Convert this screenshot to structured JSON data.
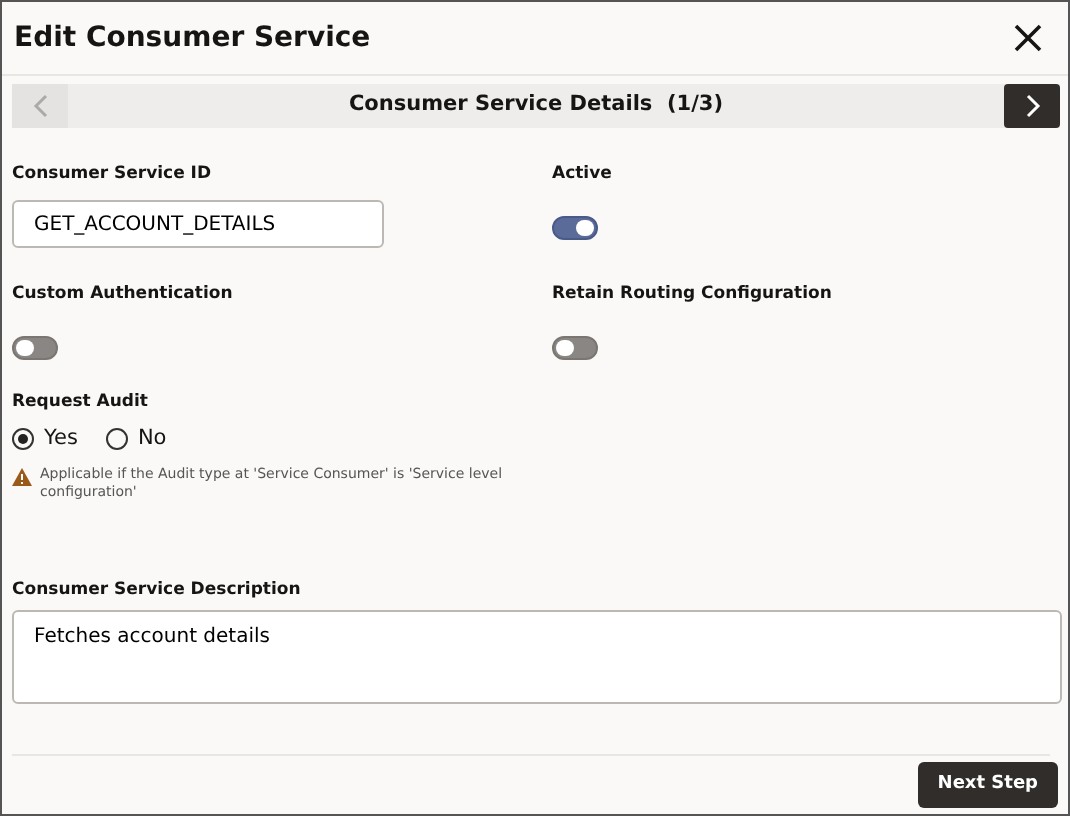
{
  "dialog": {
    "title": "Edit Consumer Service"
  },
  "stepper": {
    "title": "Consumer Service Details  (1/3)",
    "prev_disabled": true,
    "next_disabled": false
  },
  "fields": [
    {
      "label": "Consumer Service ID",
      "kind": "text",
      "value": "GET_ACCOUNT_DETAILS"
    },
    {
      "label": "Active",
      "kind": "toggle",
      "on": true
    },
    {
      "label": "Custom Authentication",
      "kind": "toggle",
      "on": false
    },
    {
      "label": "Retain Routing Configuration",
      "kind": "toggle",
      "on": false
    }
  ],
  "request_audit": {
    "label": "Request Audit",
    "options": [
      {
        "label": "Yes",
        "selected": true
      },
      {
        "label": "No",
        "selected": false
      }
    ],
    "warning": "Applicable if the Audit type at 'Service Consumer' is 'Service level configuration'"
  },
  "description": {
    "label": "Consumer Service Description",
    "value": "Fetches account details"
  },
  "footer": {
    "buttons": [
      "Next Step"
    ]
  }
}
